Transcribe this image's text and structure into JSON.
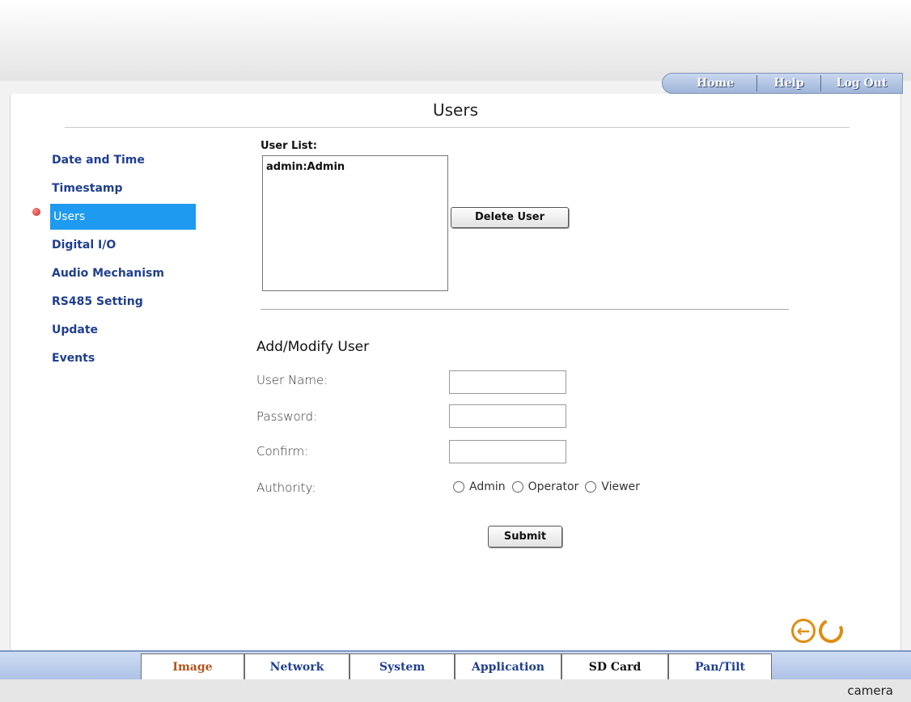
{
  "topnav": {
    "home": "Home",
    "help": "Help",
    "logout": "Log Out"
  },
  "page": {
    "title": "Users"
  },
  "sidebar": {
    "items": [
      {
        "label": "Date and Time"
      },
      {
        "label": "Timestamp"
      },
      {
        "label": "Users"
      },
      {
        "label": "Digital I/O"
      },
      {
        "label": "Audio Mechanism"
      },
      {
        "label": "RS485 Setting"
      },
      {
        "label": "Update"
      },
      {
        "label": "Events"
      }
    ],
    "active": "Users"
  },
  "user_list": {
    "label": "User List:",
    "entries": [
      "admin:Admin"
    ],
    "delete_label": "Delete User"
  },
  "form": {
    "title": "Add/Modify User",
    "username_label": "User Name:",
    "username_value": "",
    "password_label": "Password:",
    "password_value": "",
    "confirm_label": "Confirm:",
    "confirm_value": "",
    "authority_label": "Authority:",
    "authority_options": [
      "Admin",
      "Operator",
      "Viewer"
    ],
    "submit_label": "Submit"
  },
  "bottom_tabs": [
    {
      "label": "Image",
      "color": "#b0541c"
    },
    {
      "label": "Network",
      "color": "#1f3f8f"
    },
    {
      "label": "System",
      "color": "#1f3f8f"
    },
    {
      "label": "Application",
      "color": "#1f3f8f"
    },
    {
      "label": "SD Card",
      "color": "#111111"
    },
    {
      "label": "Pan/Tilt",
      "color": "#1f3f8f"
    }
  ],
  "footer": {
    "brand": "camera"
  },
  "icons": {
    "back": "back-arrow-icon",
    "refresh": "refresh-icon"
  },
  "colors": {
    "accent": "#1e9af0",
    "nav_link": "#1f3f8f",
    "icon_orange": "#e08c12"
  }
}
